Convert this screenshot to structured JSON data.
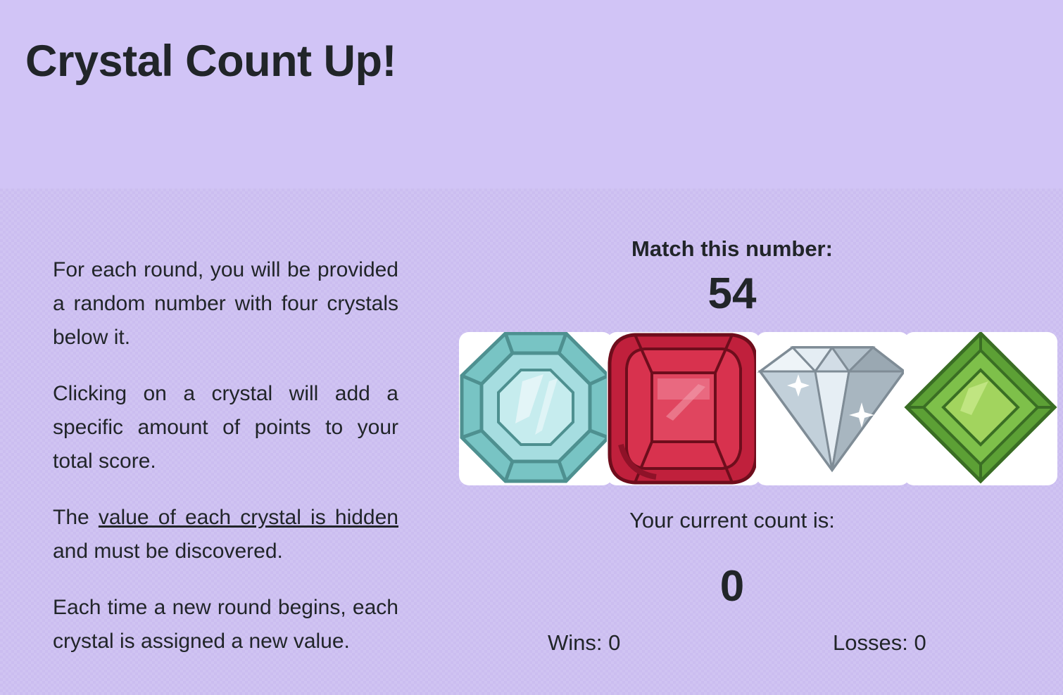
{
  "header": {
    "title": "Crystal Count Up!"
  },
  "instructions": {
    "p1": "For each round, you will be provided a random number with four crystals below it.",
    "p2": "Clicking on a crystal will add a specific amount of points to your total score.",
    "p3_before": "The ",
    "p3_highlight": "value of each crystal is hidden",
    "p3_after": " and must be discovered.",
    "p4": "Each time a new round begins, each crystal is assigned a new value."
  },
  "game": {
    "match_label": "Match this number:",
    "target_number": "54",
    "crystals": [
      {
        "icon": "teal-octagon-gem-icon",
        "color": "#8fcfd0"
      },
      {
        "icon": "red-ruby-gem-icon",
        "color": "#c8203c"
      },
      {
        "icon": "white-diamond-gem-icon",
        "color": "#c8d6e0"
      },
      {
        "icon": "green-emerald-gem-icon",
        "color": "#7fc240"
      }
    ],
    "count_label": "Your current count is:",
    "current_count": "0",
    "wins_label": "Wins: 0",
    "losses_label": "Losses: 0"
  },
  "colors": {
    "header_bg": "#d1c4f6",
    "main_bg": "#cbbdf0",
    "text": "#212529"
  }
}
